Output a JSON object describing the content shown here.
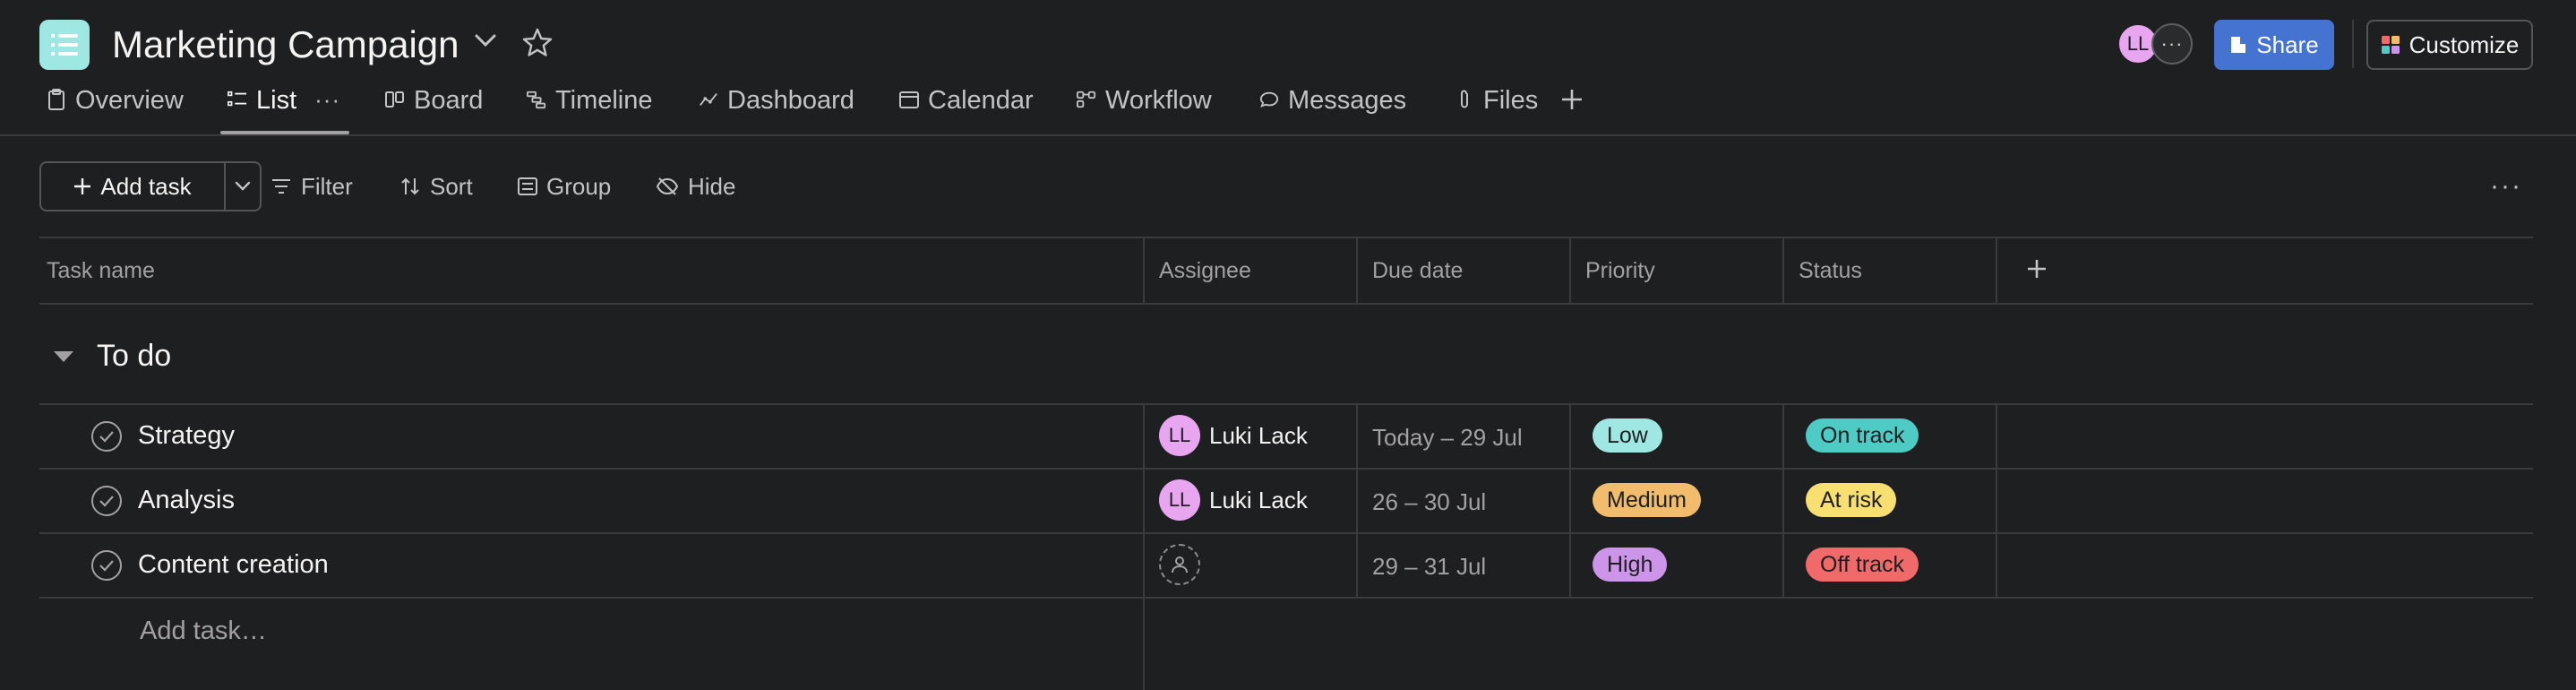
{
  "header": {
    "title": "Marketing Campaign",
    "avatar_initials": "LL",
    "more_glyph": "···",
    "share_label": "Share",
    "customize_label": "Customize"
  },
  "tabs": [
    {
      "label": "Overview",
      "icon": "clipboard-icon"
    },
    {
      "label": "List",
      "icon": "list-icon",
      "active": true
    },
    {
      "label": "Board",
      "icon": "board-icon"
    },
    {
      "label": "Timeline",
      "icon": "timeline-icon"
    },
    {
      "label": "Dashboard",
      "icon": "dashboard-icon"
    },
    {
      "label": "Calendar",
      "icon": "calendar-icon"
    },
    {
      "label": "Workflow",
      "icon": "workflow-icon"
    },
    {
      "label": "Messages",
      "icon": "message-icon"
    },
    {
      "label": "Files",
      "icon": "paperclip-icon"
    }
  ],
  "toolbar": {
    "add_task_label": "Add task",
    "filter_label": "Filter",
    "sort_label": "Sort",
    "group_label": "Group",
    "hide_label": "Hide"
  },
  "columns": {
    "task_name": "Task name",
    "assignee": "Assignee",
    "due_date": "Due date",
    "priority": "Priority",
    "status": "Status"
  },
  "section": {
    "title": "To do"
  },
  "tasks": [
    {
      "name": "Strategy",
      "assignee": "Luki Lack",
      "assignee_initials": "LL",
      "due": "Today – 29 Jul",
      "priority": "Low",
      "status": "On track"
    },
    {
      "name": "Analysis",
      "assignee": "Luki Lack",
      "assignee_initials": "LL",
      "due": "26 – 30 Jul",
      "priority": "Medium",
      "status": "At risk"
    },
    {
      "name": "Content creation",
      "assignee": "",
      "assignee_initials": "",
      "due": "29 – 31 Jul",
      "priority": "High",
      "status": "Off track"
    }
  ],
  "add_task_row": "Add task…",
  "colors": {
    "priority_low": "#9ee7e3",
    "priority_medium": "#f1bd6c",
    "priority_high": "#cd95ea",
    "status_on_track": "#4ecbc4",
    "status_at_risk": "#f8df72",
    "status_off_track": "#f06a6a",
    "share_button": "#4573d2",
    "avatar": "#e8a6f0"
  }
}
